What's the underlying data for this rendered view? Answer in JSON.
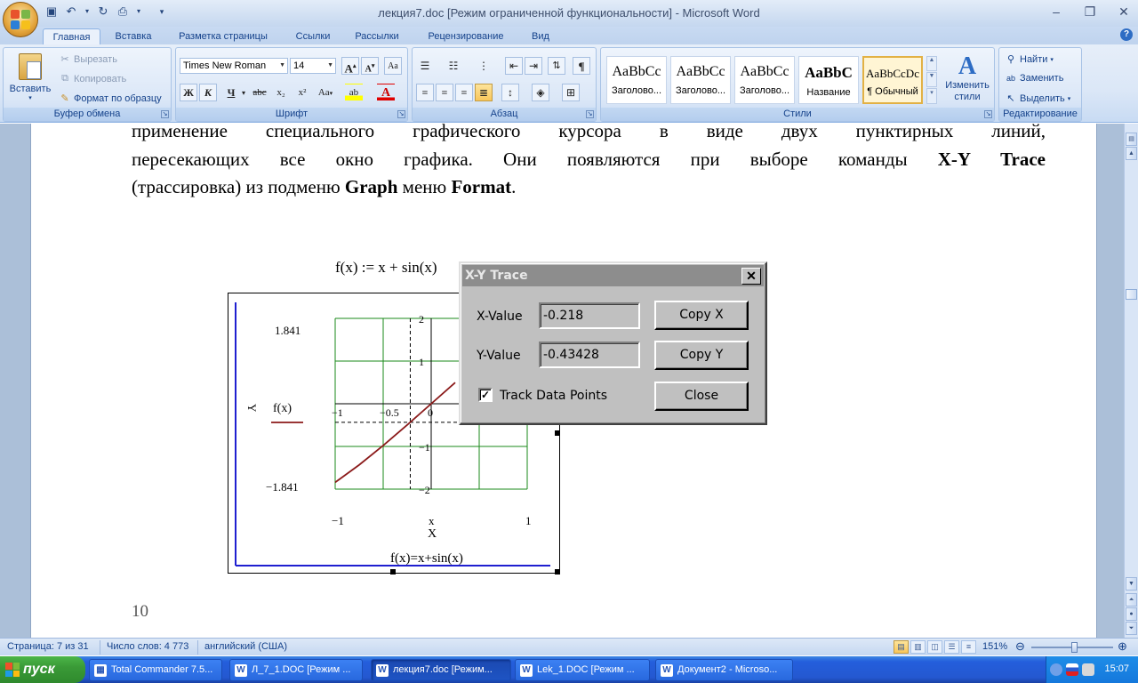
{
  "window": {
    "title": "лекция7.doc [Режим ограниченной функциональности] - Microsoft Word",
    "min_icon": "minimize-icon",
    "max_icon": "restore-icon",
    "close_icon": "close-icon"
  },
  "tabs": [
    "Главная",
    "Вставка",
    "Разметка страницы",
    "Ссылки",
    "Рассылки",
    "Рецензирование",
    "Вид"
  ],
  "ribbon": {
    "clipboard": {
      "label": "Буфер обмена",
      "paste": "Вставить",
      "cut": "Вырезать",
      "copy": "Копировать",
      "format_painter": "Формат по образцу"
    },
    "font": {
      "label": "Шрифт",
      "family": "Times New Roman",
      "size": "14",
      "bold": "Ж",
      "italic": "К",
      "underline": "Ч",
      "strike": "abc",
      "sub": "x₂",
      "sup": "x²",
      "case": "Aa",
      "grow": "A",
      "shrink": "A",
      "font_color": "A"
    },
    "paragraph": {
      "label": "Абзац",
      "pilcrow": "¶"
    },
    "styles": {
      "label": "Стили",
      "items": [
        {
          "sample": "AaBbCc",
          "name": "Заголово..."
        },
        {
          "sample": "AaBbCc",
          "name": "Заголово..."
        },
        {
          "sample": "AaBbCc",
          "name": "Заголово..."
        },
        {
          "sample": "AaBbC",
          "name": "Название"
        },
        {
          "sample": "AaBbCcDc",
          "name": "¶ Обычный"
        }
      ],
      "change": "Изменить стили"
    },
    "editing": {
      "label": "Редактирование",
      "find": "Найти",
      "replace": "Заменить",
      "select": "Выделить"
    }
  },
  "document": {
    "line1": "применение специального графического курсора в виде двух пунктирных линий,",
    "line2_pre": "пересекающих все окно графика. Они появляются при выборе команды ",
    "line2_b": "X-Y Trace",
    "line3_a": "(трассировка) из подменю ",
    "line3_b": "Graph",
    "line3_c": " меню ",
    "line3_d": "Format",
    "line3_e": ".",
    "page_number": "10"
  },
  "graph": {
    "formula": "f(x) := x + sin(x)",
    "caption": "f(x)=x+sin(x)",
    "y_label": "Y",
    "x_label": "X",
    "x_var": "x",
    "legend": "f(x)",
    "ymax_label": "1.841",
    "ymin_label": "−1.841",
    "xmin_label": "−1",
    "xmax_label": "1",
    "inner_x_ticks": [
      "−1",
      "−0.5",
      "0"
    ],
    "inner_y_ticks": [
      "2",
      "1",
      "−1",
      "−2"
    ]
  },
  "chart_data": {
    "type": "line",
    "title": "f(x)=x+sin(x)",
    "xlabel": "X",
    "ylabel": "Y",
    "xlim": [
      -1,
      1
    ],
    "ylim": [
      -1.841,
      1.841
    ],
    "series": [
      {
        "name": "f(x)",
        "x": [
          -1,
          -0.75,
          -0.5,
          -0.25,
          0,
          0.25
        ],
        "y": [
          -1.841,
          -1.432,
          -0.979,
          -0.497,
          0,
          0.497
        ]
      }
    ],
    "trace_point": {
      "x": -0.218,
      "y": -0.43428
    },
    "grid": true
  },
  "dialog": {
    "title": "X-Y Trace",
    "x_label": "X-Value",
    "y_label": "Y-Value",
    "x_value": "-0.218",
    "y_value": "-0.43428",
    "copy_x": "Copy X",
    "copy_y": "Copy Y",
    "close": "Close",
    "track": "Track Data Points",
    "track_checked": true
  },
  "statusbar": {
    "page": "Страница: 7 из 31",
    "words": "Число слов: 4 773",
    "lang": "английский (США)",
    "zoom": "151%"
  },
  "taskbar": {
    "start": "пуск",
    "tasks": [
      "Total Commander 7.5...",
      "Л_7_1.DOC [Режим ...",
      "лекция7.doc [Режим...",
      "Lek_1.DOC [Режим ...",
      "Документ2 - Microso..."
    ],
    "clock": "15:07"
  },
  "colors": {
    "curve": "#8b1a1a",
    "grid": "#1a8a1a",
    "axis_blue": "#1f1fd0",
    "ribbon_text": "#15428b"
  }
}
